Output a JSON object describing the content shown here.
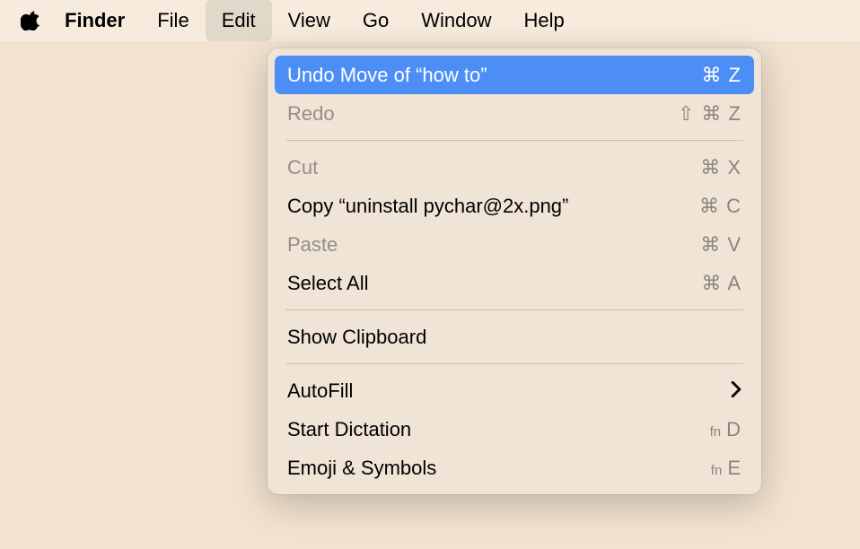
{
  "menubar": {
    "app_name": "Finder",
    "items": [
      {
        "label": "File"
      },
      {
        "label": "Edit"
      },
      {
        "label": "View"
      },
      {
        "label": "Go"
      },
      {
        "label": "Window"
      },
      {
        "label": "Help"
      }
    ],
    "open_index": 1
  },
  "dropdown": {
    "items": [
      {
        "label": "Undo Move of “how to”",
        "shortcut": "⌘ Z",
        "enabled": true,
        "highlighted": true
      },
      {
        "label": "Redo",
        "shortcut": "⇧ ⌘ Z",
        "enabled": false
      },
      {
        "separator": true
      },
      {
        "label": "Cut",
        "shortcut": "⌘ X",
        "enabled": false
      },
      {
        "label": "Copy “uninstall pychar@2x.png”",
        "shortcut": "⌘ C",
        "enabled": true
      },
      {
        "label": "Paste",
        "shortcut": "⌘ V",
        "enabled": false
      },
      {
        "label": "Select All",
        "shortcut": "⌘ A",
        "enabled": true
      },
      {
        "separator": true
      },
      {
        "label": "Show Clipboard",
        "shortcut": "",
        "enabled": true
      },
      {
        "separator": true
      },
      {
        "label": "AutoFill",
        "shortcut": "",
        "submenu": true,
        "enabled": true
      },
      {
        "label": "Start Dictation",
        "shortcut": "D",
        "fn": true,
        "enabled": true
      },
      {
        "label": "Emoji & Symbols",
        "shortcut": "E",
        "fn": true,
        "enabled": true
      }
    ]
  }
}
